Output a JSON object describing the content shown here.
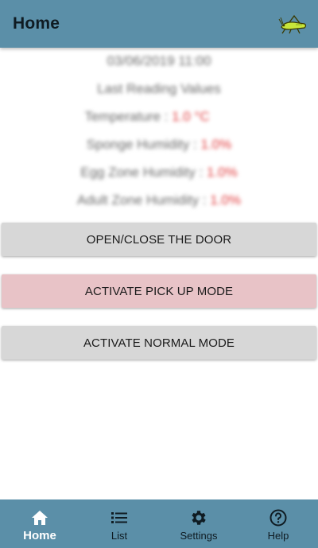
{
  "app_bar": {
    "title": "Home",
    "logo_icon": "grasshopper-logo-icon"
  },
  "readings": {
    "datetime": "03/06/2019 11:00",
    "heading": "Last Reading Values",
    "temperature": {
      "label": "Temperature : ",
      "value": "1.0 °C"
    },
    "sponge_humidity": {
      "label": "Sponge Humidity : ",
      "value": "1.0%"
    },
    "egg_zone_humidity": {
      "label": "Egg Zone Humidity : ",
      "value": "1.0%"
    },
    "adult_zone_humidity": {
      "label": "Adult Zone Humidity : ",
      "value": "1.0%"
    },
    "value_color": "#e0393b"
  },
  "actions": {
    "door_label": "OPEN/CLOSE THE DOOR",
    "pickup_label": "ACTIVATE PICK UP MODE",
    "normal_label": "ACTIVATE NORMAL MODE"
  },
  "bottom_nav": {
    "items": [
      {
        "label": "Home",
        "icon": "home-icon",
        "active": true
      },
      {
        "label": "List",
        "icon": "list-icon",
        "active": false
      },
      {
        "label": "Settings",
        "icon": "gear-icon",
        "active": false
      },
      {
        "label": "Help",
        "icon": "help-icon",
        "active": false
      }
    ]
  },
  "colors": {
    "primary": "#5b8fa8",
    "pickup_button": "#e8c3c7",
    "neutral_button": "#d7d7d7"
  }
}
